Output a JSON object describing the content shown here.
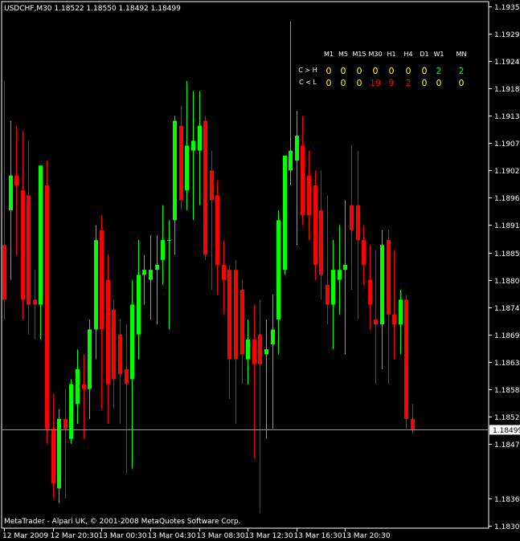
{
  "header": {
    "symbol": "USDCHF,M30",
    "open": "1.18522",
    "high": "1.18550",
    "low": "1.18492",
    "close": "1.18499"
  },
  "footer": "MetaTrader - Alpari UK, © 2001-2008 MetaQuotes Software Corp.",
  "colors": {
    "bull": "#00ff00",
    "bear": "#ff0000",
    "yellow": "#ffff00",
    "text": "#ffffff",
    "axis": "#ffffff",
    "price_line": "#8a9aa6",
    "background": "#000000"
  },
  "indicator": {
    "timeframes": [
      "M1",
      "M5",
      "M15",
      "M30",
      "H1",
      "H4",
      "D1",
      "W1",
      "MN"
    ],
    "rows": [
      {
        "label": "C > H",
        "values": [
          0,
          0,
          0,
          0,
          0,
          0,
          0,
          2,
          2
        ],
        "colors": [
          "yellow",
          "yellow",
          "yellow",
          "yellow",
          "yellow",
          "yellow",
          "yellow",
          "bull",
          "bull"
        ]
      },
      {
        "label": "C < L",
        "values": [
          0,
          0,
          0,
          19,
          9,
          2,
          0,
          0,
          0
        ],
        "colors": [
          "yellow",
          "yellow",
          "yellow",
          "bear",
          "bear",
          "bear",
          "yellow",
          "yellow",
          "yellow"
        ]
      }
    ]
  },
  "chart_data": {
    "type": "candlestick",
    "ylim": [
      1.183,
      1.1936
    ],
    "y_ticks": [
      "1.19350",
      "1.19295",
      "1.19240",
      "1.19185",
      "1.19130",
      "1.19075",
      "1.19020",
      "1.18965",
      "1.18910",
      "1.18855",
      "1.18800",
      "1.18745",
      "1.18690",
      "1.18635",
      "1.18580",
      "1.18525",
      "1.18470",
      "1.18360",
      "1.18305"
    ],
    "current_price": "1.18499",
    "x_ticks": [
      "12 Mar 2009",
      "12 Mar 20:30",
      "13 Mar 00:30",
      "13 Mar 04:30",
      "13 Mar 08:30",
      "13 Mar 12:30",
      "13 Mar 16:30",
      "13 Mar 20:30"
    ],
    "candles": [
      {
        "o": 1.1887,
        "h": 1.192,
        "l": 1.1872,
        "c": 1.1876
      },
      {
        "o": 1.1894,
        "h": 1.1912,
        "l": 1.188,
        "c": 1.1901
      },
      {
        "o": 1.1901,
        "h": 1.1911,
        "l": 1.1885,
        "c": 1.1899
      },
      {
        "o": 1.1898,
        "h": 1.191,
        "l": 1.1872,
        "c": 1.1876
      },
      {
        "o": 1.1897,
        "h": 1.1908,
        "l": 1.1869,
        "c": 1.1875
      },
      {
        "o": 1.1876,
        "h": 1.1882,
        "l": 1.1868,
        "c": 1.1875
      },
      {
        "o": 1.1875,
        "h": 1.1903,
        "l": 1.1868,
        "c": 1.1903
      },
      {
        "o": 1.1899,
        "h": 1.1904,
        "l": 1.1847,
        "c": 1.185
      },
      {
        "o": 1.185,
        "h": 1.1857,
        "l": 1.1836,
        "c": 1.1839
      },
      {
        "o": 1.1838,
        "h": 1.1854,
        "l": 1.1835,
        "c": 1.1852
      },
      {
        "o": 1.1852,
        "h": 1.1858,
        "l": 1.1836,
        "c": 1.185
      },
      {
        "o": 1.1848,
        "h": 1.186,
        "l": 1.1847,
        "c": 1.1859
      },
      {
        "o": 1.1855,
        "h": 1.1866,
        "l": 1.1851,
        "c": 1.1862
      },
      {
        "o": 1.1859,
        "h": 1.1865,
        "l": 1.1848,
        "c": 1.1858
      },
      {
        "o": 1.1858,
        "h": 1.1872,
        "l": 1.1852,
        "c": 1.187
      },
      {
        "o": 1.187,
        "h": 1.1891,
        "l": 1.1864,
        "c": 1.1888
      },
      {
        "o": 1.189,
        "h": 1.1893,
        "l": 1.1854,
        "c": 1.187
      },
      {
        "o": 1.188,
        "h": 1.1885,
        "l": 1.1851,
        "c": 1.1859
      },
      {
        "o": 1.1874,
        "h": 1.1876,
        "l": 1.1854,
        "c": 1.186
      },
      {
        "o": 1.1869,
        "h": 1.1872,
        "l": 1.1851,
        "c": 1.1861
      },
      {
        "o": 1.1862,
        "h": 1.1871,
        "l": 1.1841,
        "c": 1.1859
      },
      {
        "o": 1.186,
        "h": 1.188,
        "l": 1.1842,
        "c": 1.1875
      },
      {
        "o": 1.1869,
        "h": 1.1888,
        "l": 1.1864,
        "c": 1.1881
      },
      {
        "o": 1.1881,
        "h": 1.1885,
        "l": 1.1875,
        "c": 1.1882
      },
      {
        "o": 1.188,
        "h": 1.1889,
        "l": 1.1872,
        "c": 1.1882
      },
      {
        "o": 1.1882,
        "h": 1.1889,
        "l": 1.1871,
        "c": 1.1883
      },
      {
        "o": 1.1884,
        "h": 1.1895,
        "l": 1.1879,
        "c": 1.1888
      },
      {
        "o": 1.1888,
        "h": 1.1892,
        "l": 1.187,
        "c": 1.1888
      },
      {
        "o": 1.1892,
        "h": 1.1913,
        "l": 1.1885,
        "c": 1.1912
      },
      {
        "o": 1.1911,
        "h": 1.1915,
        "l": 1.1894,
        "c": 1.1896
      },
      {
        "o": 1.1898,
        "h": 1.192,
        "l": 1.1894,
        "c": 1.1907
      },
      {
        "o": 1.1906,
        "h": 1.1918,
        "l": 1.1892,
        "c": 1.1908
      },
      {
        "o": 1.1906,
        "h": 1.1918,
        "l": 1.1895,
        "c": 1.1911
      },
      {
        "o": 1.1912,
        "h": 1.1913,
        "l": 1.1884,
        "c": 1.1885
      },
      {
        "o": 1.1902,
        "h": 1.1906,
        "l": 1.1878,
        "c": 1.1896
      },
      {
        "o": 1.1897,
        "h": 1.19,
        "l": 1.1877,
        "c": 1.1883
      },
      {
        "o": 1.1883,
        "h": 1.1888,
        "l": 1.1873,
        "c": 1.188
      },
      {
        "o": 1.1882,
        "h": 1.1883,
        "l": 1.1856,
        "c": 1.1864
      },
      {
        "o": 1.1882,
        "h": 1.1884,
        "l": 1.1851,
        "c": 1.1864
      },
      {
        "o": 1.1878,
        "h": 1.188,
        "l": 1.1859,
        "c": 1.1865
      },
      {
        "o": 1.1864,
        "h": 1.1872,
        "l": 1.1859,
        "c": 1.1868
      },
      {
        "o": 1.1868,
        "h": 1.1875,
        "l": 1.1844,
        "c": 1.1863
      },
      {
        "o": 1.1869,
        "h": 1.1876,
        "l": 1.1833,
        "c": 1.1863
      },
      {
        "o": 1.1865,
        "h": 1.1872,
        "l": 1.1848,
        "c": 1.1866
      },
      {
        "o": 1.1867,
        "h": 1.1877,
        "l": 1.185,
        "c": 1.187
      },
      {
        "o": 1.1872,
        "h": 1.1894,
        "l": 1.1865,
        "c": 1.1892
      },
      {
        "o": 1.1882,
        "h": 1.1905,
        "l": 1.1881,
        "c": 1.1905
      },
      {
        "o": 1.1902,
        "h": 1.1932,
        "l": 1.1899,
        "c": 1.1906
      },
      {
        "o": 1.1904,
        "h": 1.1914,
        "l": 1.1887,
        "c": 1.1909
      },
      {
        "o": 1.1907,
        "h": 1.1913,
        "l": 1.1891,
        "c": 1.1893
      },
      {
        "o": 1.1901,
        "h": 1.1906,
        "l": 1.1888,
        "c": 1.1893
      },
      {
        "o": 1.1899,
        "h": 1.1902,
        "l": 1.188,
        "c": 1.1883
      },
      {
        "o": 1.1894,
        "h": 1.1902,
        "l": 1.1876,
        "c": 1.1881
      },
      {
        "o": 1.1879,
        "h": 1.1897,
        "l": 1.1871,
        "c": 1.1875
      },
      {
        "o": 1.1875,
        "h": 1.1888,
        "l": 1.1866,
        "c": 1.1882
      },
      {
        "o": 1.188,
        "h": 1.1891,
        "l": 1.1873,
        "c": 1.1882
      },
      {
        "o": 1.1882,
        "h": 1.1896,
        "l": 1.1865,
        "c": 1.1883
      },
      {
        "o": 1.1895,
        "h": 1.1907,
        "l": 1.1878,
        "c": 1.189
      },
      {
        "o": 1.1895,
        "h": 1.1906,
        "l": 1.1872,
        "c": 1.1888
      },
      {
        "o": 1.1888,
        "h": 1.1891,
        "l": 1.1879,
        "c": 1.1883
      },
      {
        "o": 1.188,
        "h": 1.1887,
        "l": 1.187,
        "c": 1.1875
      },
      {
        "o": 1.1872,
        "h": 1.1886,
        "l": 1.1859,
        "c": 1.1871
      },
      {
        "o": 1.1871,
        "h": 1.189,
        "l": 1.1862,
        "c": 1.1887
      },
      {
        "o": 1.1888,
        "h": 1.189,
        "l": 1.1859,
        "c": 1.1873
      },
      {
        "o": 1.1873,
        "h": 1.1886,
        "l": 1.1864,
        "c": 1.1871
      },
      {
        "o": 1.1871,
        "h": 1.1878,
        "l": 1.1865,
        "c": 1.1876
      },
      {
        "o": 1.1876,
        "h": 1.1877,
        "l": 1.185,
        "c": 1.1852
      },
      {
        "o": 1.1852,
        "h": 1.1855,
        "l": 1.1849,
        "c": 1.18499
      }
    ]
  }
}
